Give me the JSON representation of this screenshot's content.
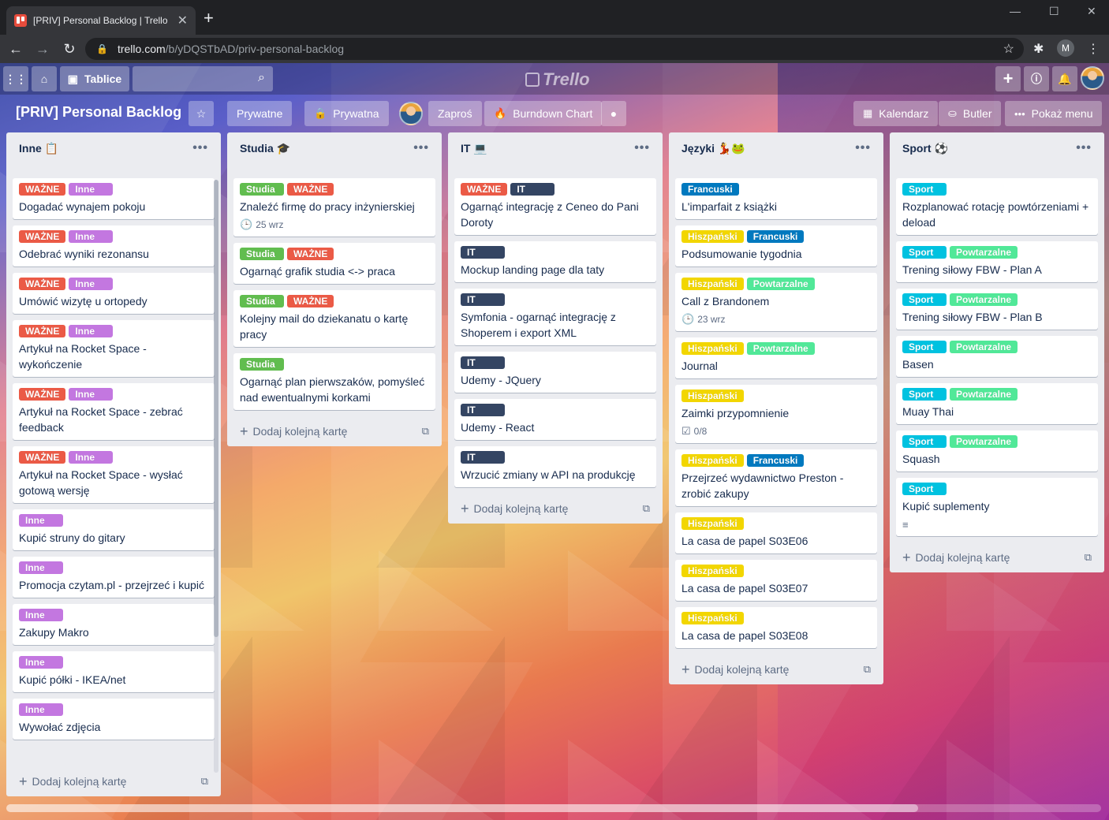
{
  "browser": {
    "tab_title": "[PRIV] Personal Backlog | Trello",
    "url_host": "trello.com",
    "url_path": "/b/yDQSTbAD/priv-personal-backlog",
    "profile_initial": "M"
  },
  "header": {
    "boards_label": "Tablice",
    "logo_text": "Trello"
  },
  "board": {
    "title": "[PRIV] Personal Backlog",
    "visibility_private": "Prywatne",
    "team_private": "Prywatna",
    "invite_label": "Zaproś",
    "burndown_label": "Burndown Chart",
    "calendar_label": "Kalendarz",
    "butler_label": "Butler",
    "menu_label": "Pokaż menu"
  },
  "colors": {
    "red": "#eb5a46",
    "purple": "#c377e0",
    "green": "#61bd4f",
    "navy": "#344563",
    "blue": "#0079bf",
    "yellow": "#f2d600",
    "lime": "#51e898",
    "sky": "#00c2e0"
  },
  "lists": [
    {
      "title": "Inne 📋",
      "add_label": "Dodaj kolejną kartę",
      "cards": [
        {
          "labels": [
            {
              "text": "WAŻNE",
              "color": "red"
            },
            {
              "text": "Inne",
              "color": "purple"
            }
          ],
          "title": "Dogadać wynajem pokoju"
        },
        {
          "labels": [
            {
              "text": "WAŻNE",
              "color": "red"
            },
            {
              "text": "Inne",
              "color": "purple"
            }
          ],
          "title": "Odebrać wyniki rezonansu"
        },
        {
          "labels": [
            {
              "text": "WAŻNE",
              "color": "red"
            },
            {
              "text": "Inne",
              "color": "purple"
            }
          ],
          "title": "Umówić wizytę u ortopedy"
        },
        {
          "labels": [
            {
              "text": "WAŻNE",
              "color": "red"
            },
            {
              "text": "Inne",
              "color": "purple"
            }
          ],
          "title": "Artykuł na Rocket Space - wykończenie"
        },
        {
          "labels": [
            {
              "text": "WAŻNE",
              "color": "red"
            },
            {
              "text": "Inne",
              "color": "purple"
            }
          ],
          "title": "Artykuł na Rocket Space - zebrać feedback"
        },
        {
          "labels": [
            {
              "text": "WAŻNE",
              "color": "red"
            },
            {
              "text": "Inne",
              "color": "purple"
            }
          ],
          "title": "Artykuł na Rocket Space - wysłać gotową wersję"
        },
        {
          "labels": [
            {
              "text": "Inne",
              "color": "purple"
            }
          ],
          "title": "Kupić struny do gitary"
        },
        {
          "labels": [
            {
              "text": "Inne",
              "color": "purple"
            }
          ],
          "title": "Promocja czytam.pl - przejrzeć i kupić"
        },
        {
          "labels": [
            {
              "text": "Inne",
              "color": "purple"
            }
          ],
          "title": "Zakupy Makro"
        },
        {
          "labels": [
            {
              "text": "Inne",
              "color": "purple"
            }
          ],
          "title": "Kupić półki - IKEA/net"
        },
        {
          "labels": [
            {
              "text": "Inne",
              "color": "purple"
            }
          ],
          "title": "Wywołać zdjęcia"
        }
      ]
    },
    {
      "title": "Studia 🎓",
      "add_label": "Dodaj kolejną kartę",
      "cards": [
        {
          "labels": [
            {
              "text": "Studia",
              "color": "green"
            },
            {
              "text": "WAŻNE",
              "color": "red"
            }
          ],
          "title": "Znaleźć firmę do pracy inżynierskiej",
          "due": "25 wrz"
        },
        {
          "labels": [
            {
              "text": "Studia",
              "color": "green"
            },
            {
              "text": "WAŻNE",
              "color": "red"
            }
          ],
          "title": "Ogarnąć grafik studia <-> praca"
        },
        {
          "labels": [
            {
              "text": "Studia",
              "color": "green"
            },
            {
              "text": "WAŻNE",
              "color": "red"
            }
          ],
          "title": "Kolejny mail do dziekanatu o kartę pracy"
        },
        {
          "labels": [
            {
              "text": "Studia",
              "color": "green"
            }
          ],
          "title": "Ogarnąć plan pierwszaków, pomyśleć nad ewentualnymi korkami"
        }
      ]
    },
    {
      "title": "IT 💻",
      "add_label": "Dodaj kolejną kartę",
      "cards": [
        {
          "labels": [
            {
              "text": "WAŻNE",
              "color": "red"
            },
            {
              "text": "IT",
              "color": "navy"
            }
          ],
          "title": "Ogarnąć integrację z Ceneo do Pani Doroty"
        },
        {
          "labels": [
            {
              "text": "IT",
              "color": "navy"
            }
          ],
          "title": "Mockup landing page dla taty"
        },
        {
          "labels": [
            {
              "text": "IT",
              "color": "navy"
            }
          ],
          "title": "Symfonia - ogarnąć integrację z Shoperem i export XML"
        },
        {
          "labels": [
            {
              "text": "IT",
              "color": "navy"
            }
          ],
          "title": "Udemy - JQuery"
        },
        {
          "labels": [
            {
              "text": "IT",
              "color": "navy"
            }
          ],
          "title": "Udemy - React"
        },
        {
          "labels": [
            {
              "text": "IT",
              "color": "navy"
            }
          ],
          "title": "Wrzucić zmiany w API na produkcję"
        }
      ]
    },
    {
      "title": "Języki 💃🐸",
      "add_label": "Dodaj kolejną kartę",
      "cards": [
        {
          "labels": [
            {
              "text": "Francuski",
              "color": "blue"
            }
          ],
          "title": "L'imparfait z książki"
        },
        {
          "labels": [
            {
              "text": "Hiszpański",
              "color": "yellow"
            },
            {
              "text": "Francuski",
              "color": "blue"
            }
          ],
          "title": "Podsumowanie tygodnia"
        },
        {
          "labels": [
            {
              "text": "Hiszpański",
              "color": "yellow"
            },
            {
              "text": "Powtarzalne",
              "color": "lime"
            }
          ],
          "title": "Call z Brandonem",
          "due": "23 wrz"
        },
        {
          "labels": [
            {
              "text": "Hiszpański",
              "color": "yellow"
            },
            {
              "text": "Powtarzalne",
              "color": "lime"
            }
          ],
          "title": "Journal"
        },
        {
          "labels": [
            {
              "text": "Hiszpański",
              "color": "yellow"
            }
          ],
          "title": "Zaimki przypomnienie",
          "checklist": "0/8"
        },
        {
          "labels": [
            {
              "text": "Hiszpański",
              "color": "yellow"
            },
            {
              "text": "Francuski",
              "color": "blue"
            }
          ],
          "title": "Przejrzeć wydawnictwo Preston - zrobić zakupy"
        },
        {
          "labels": [
            {
              "text": "Hiszpański",
              "color": "yellow"
            }
          ],
          "title": "La casa de papel S03E06"
        },
        {
          "labels": [
            {
              "text": "Hiszpański",
              "color": "yellow"
            }
          ],
          "title": "La casa de papel S03E07"
        },
        {
          "labels": [
            {
              "text": "Hiszpański",
              "color": "yellow"
            }
          ],
          "title": "La casa de papel S03E08"
        }
      ]
    },
    {
      "title": "Sport ⚽",
      "add_label": "Dodaj kolejną kartę",
      "cards": [
        {
          "labels": [
            {
              "text": "Sport",
              "color": "sky"
            }
          ],
          "title": "Rozplanować rotację powtórzeniami + deload"
        },
        {
          "labels": [
            {
              "text": "Sport",
              "color": "sky"
            },
            {
              "text": "Powtarzalne",
              "color": "lime"
            }
          ],
          "title": "Trening siłowy FBW - Plan A"
        },
        {
          "labels": [
            {
              "text": "Sport",
              "color": "sky"
            },
            {
              "text": "Powtarzalne",
              "color": "lime"
            }
          ],
          "title": "Trening siłowy FBW - Plan B"
        },
        {
          "labels": [
            {
              "text": "Sport",
              "color": "sky"
            },
            {
              "text": "Powtarzalne",
              "color": "lime"
            }
          ],
          "title": "Basen"
        },
        {
          "labels": [
            {
              "text": "Sport",
              "color": "sky"
            },
            {
              "text": "Powtarzalne",
              "color": "lime"
            }
          ],
          "title": "Muay Thai"
        },
        {
          "labels": [
            {
              "text": "Sport",
              "color": "sky"
            },
            {
              "text": "Powtarzalne",
              "color": "lime"
            }
          ],
          "title": "Squash"
        },
        {
          "labels": [
            {
              "text": "Sport",
              "color": "sky"
            }
          ],
          "title": "Kupić suplementy",
          "description": true
        }
      ]
    }
  ]
}
